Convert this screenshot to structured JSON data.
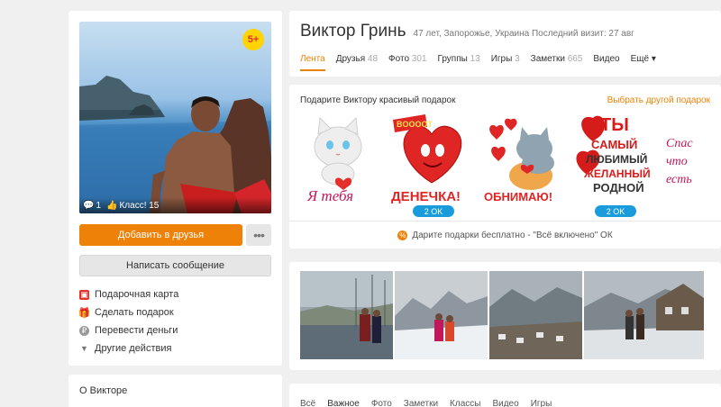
{
  "profile": {
    "age_badge": "5+",
    "comments_count": "1",
    "likes_label": "Класс! 15",
    "add_friend_label": "Добавить в друзья",
    "more_label": "•••",
    "message_label": "Написать сообщение",
    "actions": [
      {
        "label": "Подарочная карта",
        "icon": "gift-card-icon"
      },
      {
        "label": "Сделать подарок",
        "icon": "gift-icon"
      },
      {
        "label": "Перевести деньги",
        "icon": "money-transfer-icon"
      },
      {
        "label": "Другие действия",
        "icon": "triangle-down-icon"
      }
    ],
    "about_title": "О Викторе"
  },
  "header": {
    "name": "Виктор Гринь",
    "meta": "47 лет, Запорожье, Украина  Последний визит: 27 авг",
    "nav": [
      {
        "label": "Лента",
        "count": "",
        "active": true
      },
      {
        "label": "Друзья",
        "count": "48"
      },
      {
        "label": "Фото",
        "count": "301"
      },
      {
        "label": "Группы",
        "count": "13"
      },
      {
        "label": "Игры",
        "count": "3"
      },
      {
        "label": "Заметки",
        "count": "665"
      },
      {
        "label": "Видео",
        "count": ""
      },
      {
        "label": "Ещё ▾",
        "count": ""
      }
    ]
  },
  "gifts": {
    "title": "Подарите Виктору красивый подарок",
    "other_link": "Выбрать другой подарок",
    "items": [
      {
        "name": "kitten-love-gift",
        "caption": "Я тебя",
        "price": ""
      },
      {
        "name": "heart-denechka-gift",
        "caption": "ДЕНЕЧКА!",
        "price": "2 OK"
      },
      {
        "name": "cats-hug-gift",
        "caption": "ОБНИМАЮ!",
        "price": ""
      },
      {
        "name": "best-person-gift",
        "caption": "ТЫ САМЫЙ",
        "price": "2 OK"
      },
      {
        "name": "thanks-gift",
        "caption": "Спасибо что ты есть",
        "price": ""
      }
    ],
    "free_note": "Дарите подарки бесплатно - \"Всё включено\" ОК"
  },
  "feed": {
    "tabs": [
      {
        "label": "Всё",
        "active": false
      },
      {
        "label": "Важное",
        "active": true
      },
      {
        "label": "Фото",
        "active": false
      },
      {
        "label": "Заметки",
        "active": false
      },
      {
        "label": "Классы",
        "active": false
      },
      {
        "label": "Видео",
        "active": false
      },
      {
        "label": "Игры",
        "active": false
      }
    ]
  },
  "colors": {
    "accent": "#ee8208",
    "price_badge": "#1a9cdc",
    "background": "#f0f0f0"
  }
}
